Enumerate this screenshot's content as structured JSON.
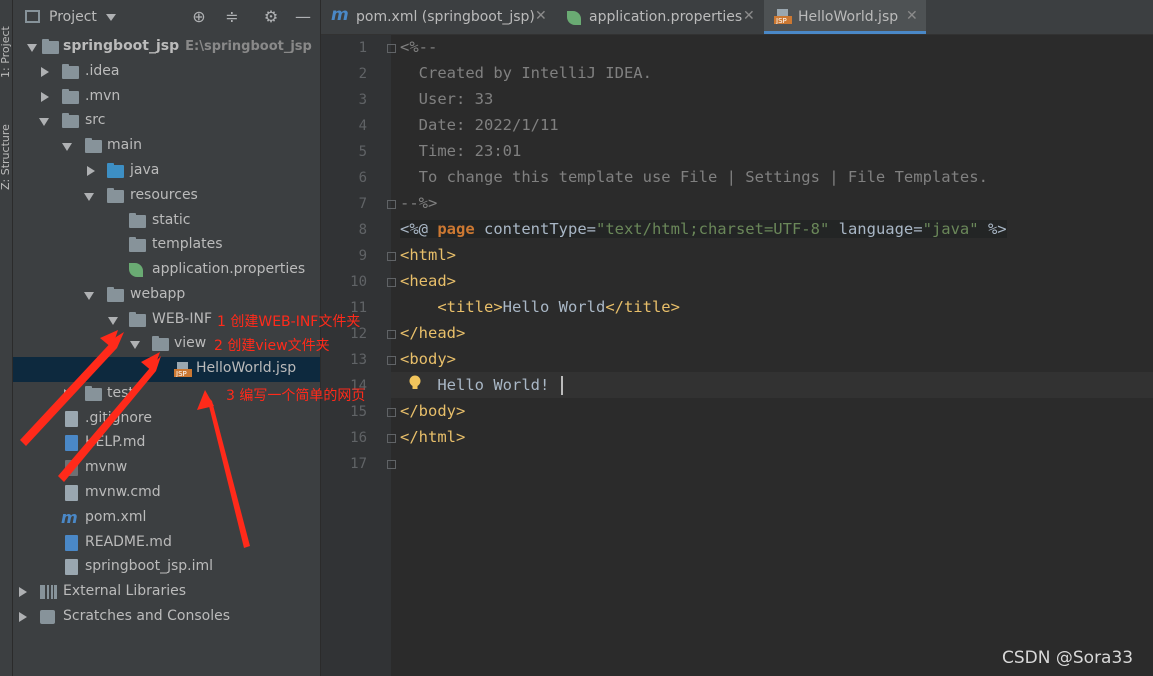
{
  "left_strip": {
    "tab1": "1: Project",
    "tab2": "Z: Structure"
  },
  "panel": {
    "title": "Project",
    "project_name": "springboot_jsp",
    "project_path": "E:\\springboot_jsp"
  },
  "tree": [
    {
      "label": ".idea"
    },
    {
      "label": ".mvn"
    },
    {
      "label": "src"
    },
    {
      "label": "main"
    },
    {
      "label": "java"
    },
    {
      "label": "resources"
    },
    {
      "label": "static"
    },
    {
      "label": "templates"
    },
    {
      "label": "application.properties"
    },
    {
      "label": "webapp"
    },
    {
      "label": "WEB-INF"
    },
    {
      "label": "view"
    },
    {
      "label": "HelloWorld.jsp"
    },
    {
      "label": "test"
    },
    {
      "label": ".gitignore"
    },
    {
      "label": "HELP.md"
    },
    {
      "label": "mvnw"
    },
    {
      "label": "mvnw.cmd"
    },
    {
      "label": "pom.xml"
    },
    {
      "label": "README.md"
    },
    {
      "label": "springboot_jsp.iml"
    },
    {
      "label": "External Libraries"
    },
    {
      "label": "Scratches and Consoles"
    }
  ],
  "tabs": [
    {
      "label": "pom.xml (springboot_jsp)"
    },
    {
      "label": "application.properties"
    },
    {
      "label": "HelloWorld.jsp"
    }
  ],
  "code": {
    "line1": "<%--",
    "line2": "  Created by IntelliJ IDEA.",
    "line3": "  User: 33",
    "line4": "  Date: 2022/1/11",
    "line5": "  Time: 23:01",
    "line6": "  To change this template use File | Settings | File Templates.",
    "line7": "--%>",
    "l8_a": "<%@ ",
    "l8_b": "page ",
    "l8_c": "contentType=",
    "l8_d": "\"text/html;charset=UTF-8\"",
    "l8_e": " language=",
    "l8_f": "\"java\"",
    "l8_g": " %>",
    "line9": "<html>",
    "line10": "<head>",
    "l11_a": "    <title>",
    "l11_b": "Hello World",
    "l11_c": "</title>",
    "line12": "</head>",
    "line13": "<body>",
    "line14": "    Hello World!",
    "line15": "</body>",
    "line16": "</html>"
  },
  "line_numbers": [
    "1",
    "2",
    "3",
    "4",
    "5",
    "6",
    "7",
    "8",
    "9",
    "10",
    "11",
    "12",
    "13",
    "14",
    "15",
    "16",
    "17"
  ],
  "annotations": {
    "a1": "1 创建WEB-INF文件夹",
    "a2": "2 创建view文件夹",
    "a3": "3 编写一个简单的网页"
  },
  "watermark": "CSDN @Sora33",
  "colors": {
    "annotation": "#ff2a1a",
    "accent": "#4a88c7",
    "selection": "#0d293e"
  }
}
